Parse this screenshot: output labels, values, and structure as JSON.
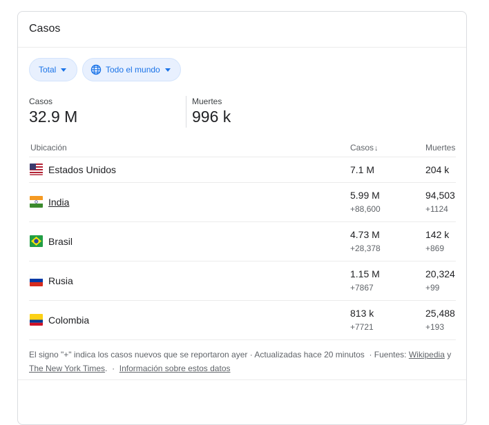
{
  "card": {
    "title": "Casos"
  },
  "filters": {
    "total_label": "Total",
    "region_label": "Todo el mundo"
  },
  "stats": {
    "cases_label": "Casos",
    "cases_value": "32.9 M",
    "deaths_label": "Muertes",
    "deaths_value": "996 k"
  },
  "table": {
    "headers": {
      "location": "Ubicación",
      "cases": "Casos",
      "cases_sort_icon": "↓",
      "deaths": "Muertes"
    },
    "rows": [
      {
        "country": "Estados Unidos",
        "flag": "us-flag",
        "cases": "7.1 M",
        "cases_delta": "",
        "deaths": "204 k",
        "deaths_delta": "",
        "link": false
      },
      {
        "country": "India",
        "flag": "india-flag",
        "cases": "5.99 M",
        "cases_delta": "+88,600",
        "deaths": "94,503",
        "deaths_delta": "+1124",
        "link": true
      },
      {
        "country": "Brasil",
        "flag": "brazil-flag",
        "cases": "4.73 M",
        "cases_delta": "+28,378",
        "deaths": "142 k",
        "deaths_delta": "+869",
        "link": false
      },
      {
        "country": "Rusia",
        "flag": "russia-flag",
        "cases": "1.15 M",
        "cases_delta": "+7867",
        "deaths": "20,324",
        "deaths_delta": "+99",
        "link": false
      },
      {
        "country": "Colombia",
        "flag": "colombia-flag",
        "cases": "813 k",
        "cases_delta": "+7721",
        "deaths": "25,488",
        "deaths_delta": "+193",
        "link": false
      }
    ]
  },
  "footer": {
    "note": "El signo \"+\" indica los casos nuevos que se reportaron ayer · Actualizadas hace 20 minutos",
    "sources_label": "· Fuentes:",
    "source1": "Wikipedia",
    "and": "y",
    "source2": "The New York Times",
    "period": ".",
    "sep": "·",
    "info_link": "Información sobre estos datos"
  },
  "colors": {
    "accent": "#1a73e8",
    "chip_bg": "#e8f0fe",
    "muted": "#5f6368"
  }
}
